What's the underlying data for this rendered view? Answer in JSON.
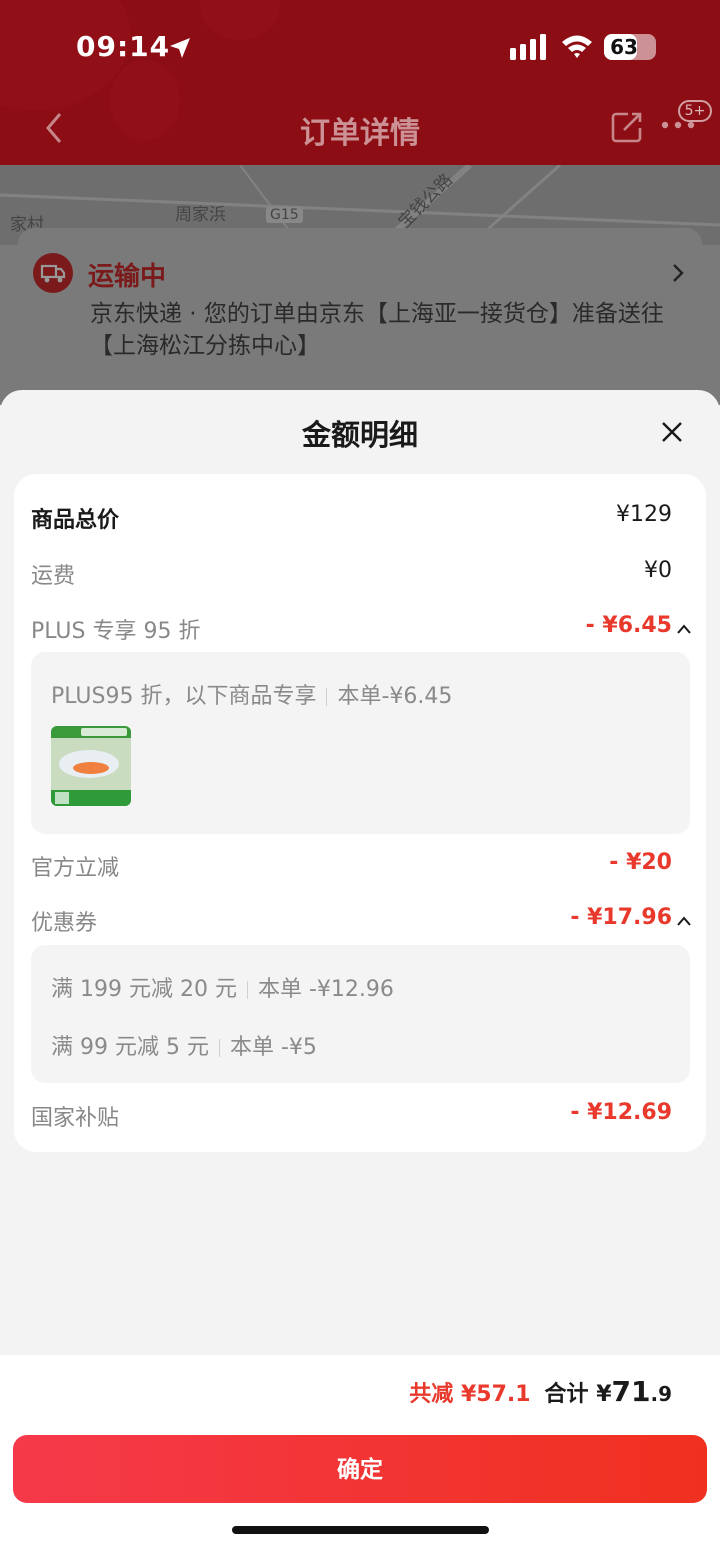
{
  "status_bar": {
    "time": "09:14",
    "battery": "63",
    "battery_level": 0.63
  },
  "nav": {
    "title": "订单详情",
    "badge": "5+"
  },
  "map": {
    "labels": [
      "周家浜",
      "G15",
      "宝钱公路",
      "家村"
    ]
  },
  "shipping": {
    "status": "运输中",
    "description": "京东快递 · 您的订单由京东【上海亚一接货仓】准备送往【上海松江分拣中心】"
  },
  "sheet": {
    "title": "金额明细",
    "rows": {
      "total_price": {
        "label": "商品总价",
        "value": "¥129"
      },
      "freight": {
        "label": "运费",
        "value": "¥0"
      },
      "plus": {
        "label": "PLUS 专享 95 折",
        "value": "- ¥6.45",
        "detail_text": "PLUS95 折，以下商品专享",
        "detail_amount": "本单-¥6.45"
      },
      "official": {
        "label": "官方立减",
        "value": "- ¥20"
      },
      "coupon": {
        "label": "优惠券",
        "value": "- ¥17.96",
        "items": [
          {
            "text": "满 199 元减 20 元",
            "amount": "本单 -¥12.96"
          },
          {
            "text": "满 99 元减 5 元",
            "amount": "本单 -¥5"
          }
        ]
      },
      "subsidy": {
        "label": "国家补贴",
        "value": "- ¥12.69"
      }
    }
  },
  "footer": {
    "saved": "共减 ¥57.1",
    "total_label": "合计 ¥",
    "total_int": "71",
    "total_dec": ".9",
    "confirm": "确定"
  },
  "colors": {
    "accent": "#e8392c",
    "button": "#f5394a",
    "header": "#8c0d14"
  }
}
